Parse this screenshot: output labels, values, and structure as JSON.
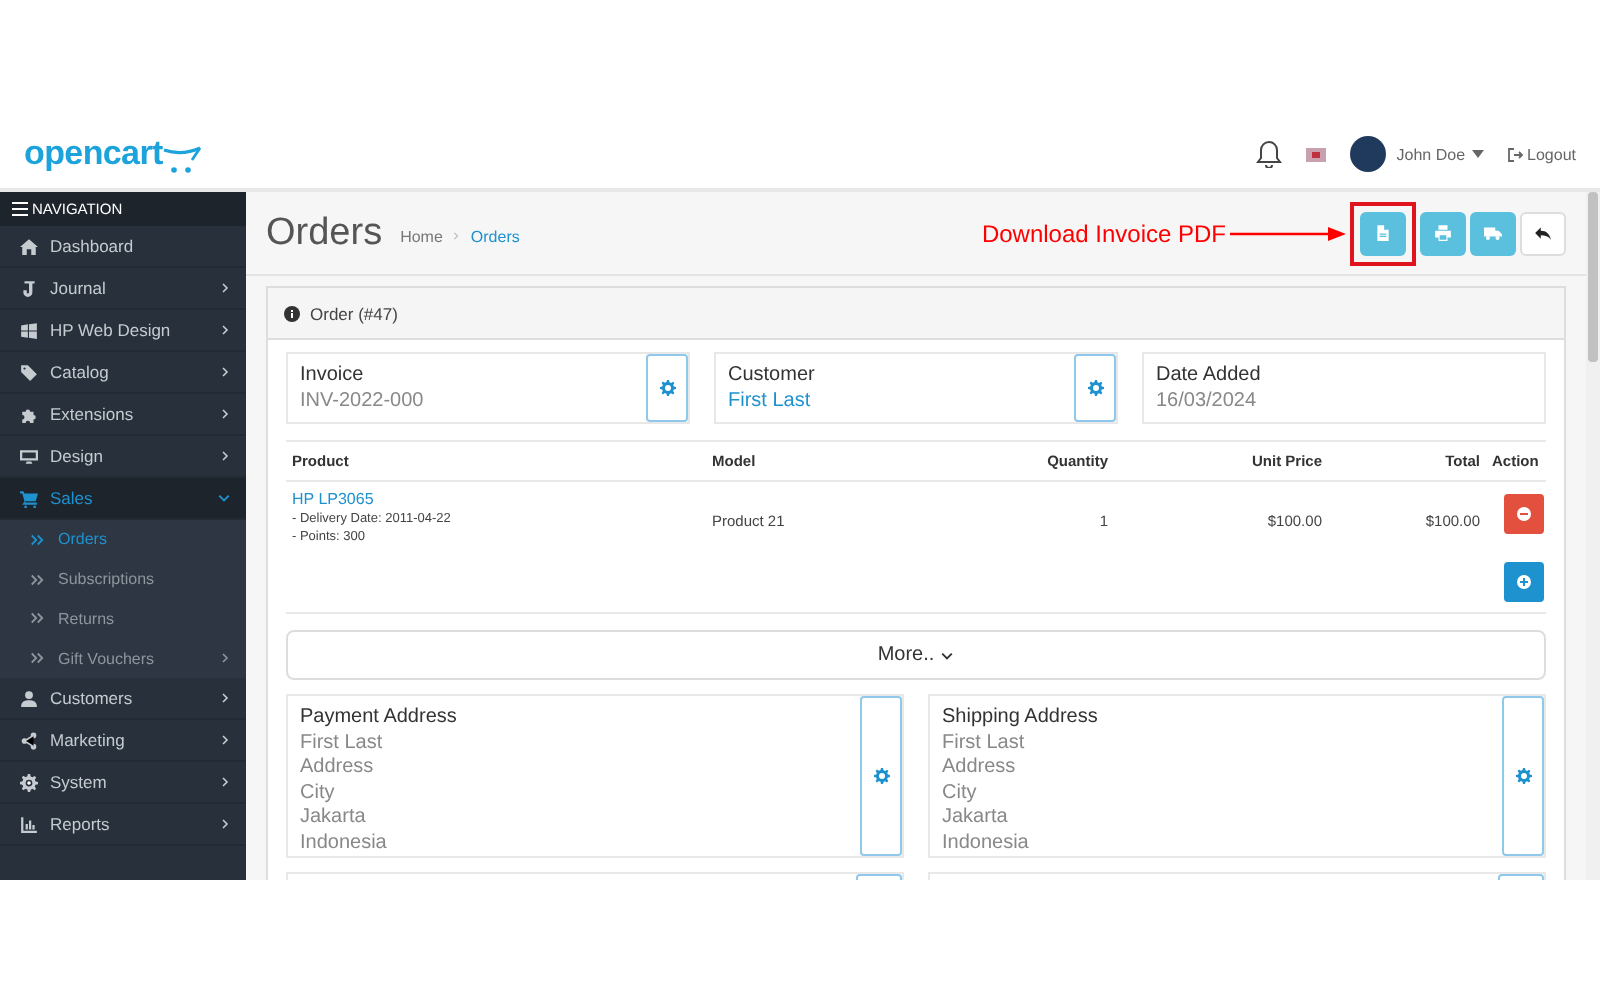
{
  "header": {
    "logo": "opencart",
    "user_name": "John Doe",
    "logout": "Logout"
  },
  "sidebar": {
    "title": "NAVIGATION",
    "items": [
      {
        "label": "Dashboard",
        "has_submenu": false,
        "selected": false
      },
      {
        "label": "Journal",
        "has_submenu": true,
        "expanded": false,
        "selected": false
      },
      {
        "label": "HP Web Design",
        "has_submenu": true,
        "expanded": false,
        "selected": false
      },
      {
        "label": "Catalog",
        "has_submenu": true,
        "expanded": false,
        "selected": false
      },
      {
        "label": "Extensions",
        "has_submenu": true,
        "expanded": false,
        "selected": false
      },
      {
        "label": "Design",
        "has_submenu": true,
        "expanded": false,
        "selected": false
      },
      {
        "label": "Sales",
        "has_submenu": true,
        "expanded": true,
        "selected": true,
        "children": [
          {
            "label": "Orders",
            "has_submenu": false,
            "selected": true
          },
          {
            "label": "Subscriptions",
            "has_submenu": false,
            "selected": false
          },
          {
            "label": "Returns",
            "has_submenu": false,
            "selected": false
          },
          {
            "label": "Gift Vouchers",
            "has_submenu": true,
            "selected": false
          }
        ]
      },
      {
        "label": "Customers",
        "has_submenu": true,
        "expanded": false,
        "selected": false
      },
      {
        "label": "Marketing",
        "has_submenu": true,
        "expanded": false,
        "selected": false
      },
      {
        "label": "System",
        "has_submenu": true,
        "expanded": false,
        "selected": false
      },
      {
        "label": "Reports",
        "has_submenu": true,
        "expanded": false,
        "selected": false
      }
    ]
  },
  "page": {
    "title": "Orders",
    "breadcrumb": [
      {
        "label": "Home",
        "selected": false
      },
      {
        "label": "Orders",
        "selected": true
      }
    ],
    "annotation": "Download Invoice PDF",
    "buttons": [
      {
        "kind": "invoice",
        "highlighted": true
      },
      {
        "kind": "print",
        "highlighted": false
      },
      {
        "kind": "shipping",
        "highlighted": false
      },
      {
        "kind": "back",
        "highlighted": false
      }
    ]
  },
  "order": {
    "title": "Order (#47)",
    "info": [
      {
        "label": "Invoice",
        "value": "INV-2022-000",
        "kind": "text",
        "editable": true
      },
      {
        "label": "Customer",
        "value": "First Last",
        "kind": "link",
        "editable": true
      },
      {
        "label": "Date Added",
        "value": "16/03/2024",
        "kind": "text",
        "editable": false
      }
    ],
    "table": {
      "columns": [
        "Product",
        "Model",
        "Quantity",
        "Unit Price",
        "Total",
        "Action"
      ],
      "rows": [
        {
          "product": "HP LP3065",
          "options": [
            "- Delivery Date: 2011-04-22",
            "- Points: 300"
          ],
          "model": "Product 21",
          "quantity": "1",
          "unit_price": "$100.00",
          "total": "$100.00",
          "actions": [
            {
              "kind": "remove"
            },
            {
              "kind": "add"
            }
          ]
        }
      ]
    },
    "more": "More..",
    "addresses": [
      {
        "title": "Payment Address",
        "lines": [
          "First Last",
          "Address",
          "City",
          "Jakarta",
          "Indonesia"
        ]
      },
      {
        "title": "Shipping Address",
        "lines": [
          "First Last",
          "Address",
          "City",
          "Jakarta",
          "Indonesia"
        ]
      }
    ]
  }
}
